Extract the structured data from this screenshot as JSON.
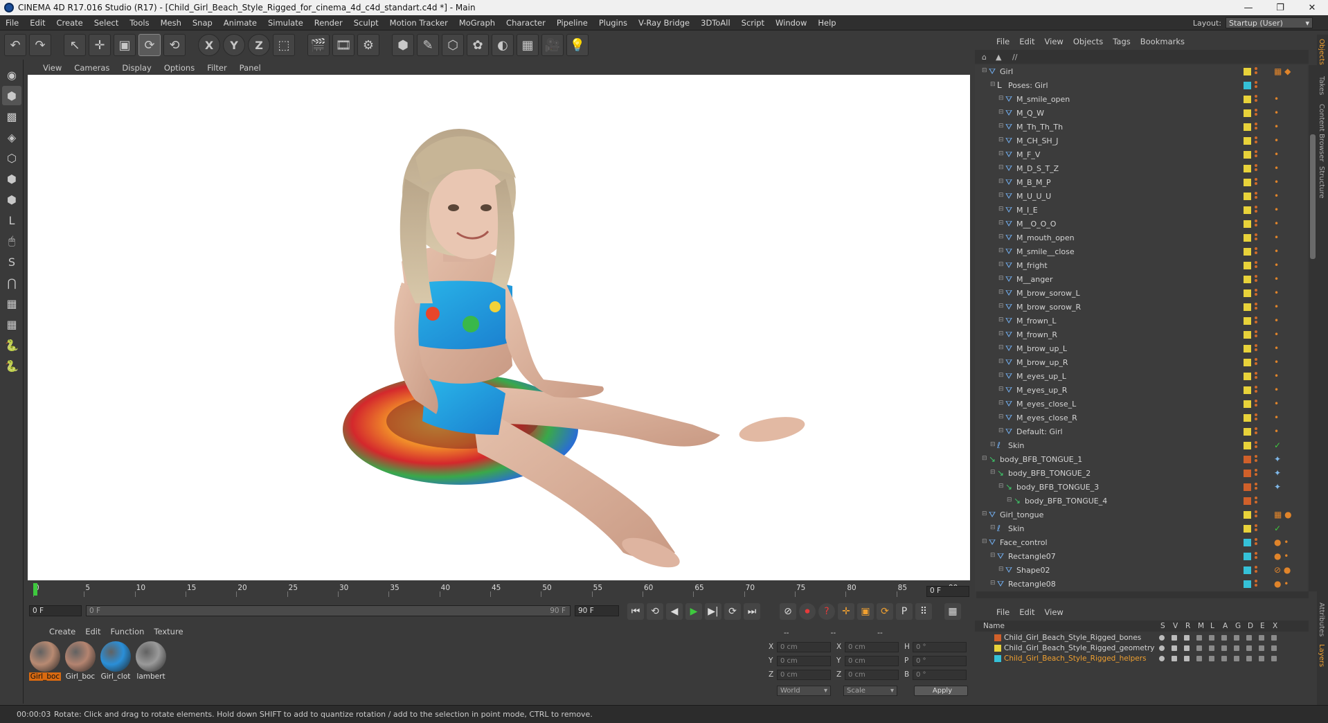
{
  "window": {
    "title": "CINEMA 4D R17.016 Studio (R17) - [Child_Girl_Beach_Style_Rigged_for_cinema_4d_c4d_standart.c4d *] - Main",
    "controls": [
      "—",
      "❐",
      "✕"
    ]
  },
  "menubar": {
    "items": [
      "File",
      "Edit",
      "Create",
      "Select",
      "Tools",
      "Mesh",
      "Snap",
      "Animate",
      "Simulate",
      "Render",
      "Sculpt",
      "Motion Tracker",
      "MoGraph",
      "Character",
      "Pipeline",
      "Plugins",
      "V-Ray Bridge",
      "3DToAll",
      "Script",
      "Window",
      "Help"
    ],
    "layout_label": "Layout:",
    "layout_value": "Startup (User)"
  },
  "toolbar": {
    "icons": [
      "undo-icon",
      "redo-icon",
      "sep",
      "select-arrow-icon",
      "move-icon",
      "scale-icon",
      "rotate-icon",
      "rotate-alt-icon",
      "sep",
      "x-axis-icon",
      "y-axis-icon",
      "z-axis-icon",
      "coordinate-system-icon",
      "sep",
      "render-view-icon",
      "render-picture-viewer-icon",
      "render-settings-icon",
      "sep",
      "cube-icon",
      "pen-icon",
      "subdivision-icon",
      "array-icon",
      "deformer-icon",
      "floor-icon",
      "camera-icon",
      "light-icon"
    ],
    "glyphs": [
      "↶",
      "↷",
      "",
      "↖",
      "✛",
      "▣",
      "⟳",
      "⟲",
      "",
      "X",
      "Y",
      "Z",
      "⬚",
      "",
      "🎬",
      "🎞",
      "⚙",
      "",
      "⬢",
      "✎",
      "⬡",
      "✿",
      "◐",
      "▦",
      "🎥",
      "💡"
    ]
  },
  "left_toolbar": {
    "icons": [
      "make-editable-icon",
      "model-mode-icon",
      "texture-mode-icon",
      "workplane-icon",
      "points-mode-icon",
      "edges-mode-icon",
      "polygons-mode-icon",
      "axis-mode-icon",
      "tweak-mode-icon",
      "solo-icon",
      "snap-magnet-icon",
      "grid-lock-icon",
      "grid-snap-icon",
      "python-icon",
      "python-alt-icon"
    ],
    "glyphs": [
      "◉",
      "⬢",
      "▩",
      "◈",
      "⬡",
      "⬢",
      "⬢",
      "L",
      "🖱",
      "S",
      "⋂",
      "▦",
      "▦",
      "🐍",
      "🐍"
    ]
  },
  "viewport": {
    "menu": [
      "View",
      "Cameras",
      "Display",
      "Options",
      "Filter",
      "Panel"
    ]
  },
  "timeline": {
    "ticks": [
      "0",
      "5",
      "10",
      "15",
      "20",
      "25",
      "30",
      "35",
      "40",
      "45",
      "50",
      "55",
      "60",
      "65",
      "70",
      "75",
      "80",
      "85",
      "90"
    ],
    "current_frame": "0 F"
  },
  "transport": {
    "start": "0 F",
    "range_start": "0 F",
    "range_end": "90 F",
    "end": "90 F",
    "buttons": [
      "⏮",
      "⟲",
      "◀",
      "▶",
      "▶|",
      "⟳",
      "⏭"
    ],
    "record_buttons": [
      "⊘",
      "⏺",
      "?",
      "✛",
      "▣",
      "⟳",
      "P",
      "⠿",
      "▦"
    ]
  },
  "materials": {
    "menu": [
      "Create",
      "Edit",
      "Function",
      "Texture"
    ],
    "items": [
      {
        "label": "Girl_boc",
        "color": "#b88a72"
      },
      {
        "label": "Girl_boc",
        "color": "#b48470"
      },
      {
        "label": "Girl_clot",
        "color": "#2a8fd8"
      },
      {
        "label": "lambert",
        "color": "#9a9a9a"
      }
    ]
  },
  "coordinates": {
    "header": [
      "--",
      "--",
      "--"
    ],
    "rows": [
      {
        "a": "X",
        "av": "0 cm",
        "b": "X",
        "bv": "0 cm",
        "c": "H",
        "cv": "0 °"
      },
      {
        "a": "Y",
        "av": "0 cm",
        "b": "Y",
        "bv": "0 cm",
        "c": "P",
        "cv": "0 °"
      },
      {
        "a": "Z",
        "av": "0 cm",
        "b": "Z",
        "bv": "0 cm",
        "c": "B",
        "cv": "0 °"
      }
    ],
    "mode1": "World",
    "mode2": "Scale",
    "apply": "Apply"
  },
  "status": {
    "time": "00:00:03",
    "message": "Rotate: Click and drag to rotate elements. Hold down SHIFT to add to quantize rotation / add to the selection in point mode, CTRL to remove."
  },
  "object_manager": {
    "menu": [
      "File",
      "Edit",
      "View",
      "Objects",
      "Tags",
      "Bookmarks"
    ],
    "path": "//",
    "rows": [
      {
        "name": "Girl",
        "indent": 0,
        "icon": "joint-icon",
        "glyph": "⛛",
        "color": "#e8d23a",
        "tags": "▦ ◆"
      },
      {
        "name": "Poses: Girl",
        "indent": 1,
        "icon": "pose-morph-icon",
        "glyph": "L",
        "color": "#35c1d8",
        "tags": ""
      },
      {
        "name": "M_smile_open",
        "indent": 2,
        "icon": "morph-icon",
        "glyph": "⛛",
        "color": "#e8d23a",
        "tags": "•"
      },
      {
        "name": "M_Q_W",
        "indent": 2,
        "icon": "morph-icon",
        "glyph": "⛛",
        "color": "#e8d23a",
        "tags": "•"
      },
      {
        "name": "M_Th_Th_Th",
        "indent": 2,
        "icon": "morph-icon",
        "glyph": "⛛",
        "color": "#e8d23a",
        "tags": "•"
      },
      {
        "name": "M_CH_SH_J",
        "indent": 2,
        "icon": "morph-icon",
        "glyph": "⛛",
        "color": "#e8d23a",
        "tags": "•"
      },
      {
        "name": "M_F_V",
        "indent": 2,
        "icon": "morph-icon",
        "glyph": "⛛",
        "color": "#e8d23a",
        "tags": "•"
      },
      {
        "name": "M_D_S_T_Z",
        "indent": 2,
        "icon": "morph-icon",
        "glyph": "⛛",
        "color": "#e8d23a",
        "tags": "•"
      },
      {
        "name": "M_B_M_P",
        "indent": 2,
        "icon": "morph-icon",
        "glyph": "⛛",
        "color": "#e8d23a",
        "tags": "•"
      },
      {
        "name": "M_U_U_U",
        "indent": 2,
        "icon": "morph-icon",
        "glyph": "⛛",
        "color": "#e8d23a",
        "tags": "•"
      },
      {
        "name": "M_I_E",
        "indent": 2,
        "icon": "morph-icon",
        "glyph": "⛛",
        "color": "#e8d23a",
        "tags": "•"
      },
      {
        "name": "M__O_O_O",
        "indent": 2,
        "icon": "morph-icon",
        "glyph": "⛛",
        "color": "#e8d23a",
        "tags": "•"
      },
      {
        "name": "M_mouth_open",
        "indent": 2,
        "icon": "morph-icon",
        "glyph": "⛛",
        "color": "#e8d23a",
        "tags": "•"
      },
      {
        "name": "M_smile__close",
        "indent": 2,
        "icon": "morph-icon",
        "glyph": "⛛",
        "color": "#e8d23a",
        "tags": "•"
      },
      {
        "name": "M_fright",
        "indent": 2,
        "icon": "morph-icon",
        "glyph": "⛛",
        "color": "#e8d23a",
        "tags": "•"
      },
      {
        "name": "M__anger",
        "indent": 2,
        "icon": "morph-icon",
        "glyph": "⛛",
        "color": "#e8d23a",
        "tags": "•"
      },
      {
        "name": "M_brow_sorow_L",
        "indent": 2,
        "icon": "morph-icon",
        "glyph": "⛛",
        "color": "#e8d23a",
        "tags": "•"
      },
      {
        "name": "M_brow_sorow_R",
        "indent": 2,
        "icon": "morph-icon",
        "glyph": "⛛",
        "color": "#e8d23a",
        "tags": "•"
      },
      {
        "name": "M_frown_L",
        "indent": 2,
        "icon": "morph-icon",
        "glyph": "⛛",
        "color": "#e8d23a",
        "tags": "•"
      },
      {
        "name": "M_frown_R",
        "indent": 2,
        "icon": "morph-icon",
        "glyph": "⛛",
        "color": "#e8d23a",
        "tags": "•"
      },
      {
        "name": "M_brow_up_L",
        "indent": 2,
        "icon": "morph-icon",
        "glyph": "⛛",
        "color": "#e8d23a",
        "tags": "•"
      },
      {
        "name": "M_brow_up_R",
        "indent": 2,
        "icon": "morph-icon",
        "glyph": "⛛",
        "color": "#e8d23a",
        "tags": "•"
      },
      {
        "name": "M_eyes_up_L",
        "indent": 2,
        "icon": "morph-icon",
        "glyph": "⛛",
        "color": "#e8d23a",
        "tags": "•"
      },
      {
        "name": "M_eyes_up_R",
        "indent": 2,
        "icon": "morph-icon",
        "glyph": "⛛",
        "color": "#e8d23a",
        "tags": "•"
      },
      {
        "name": "M_eyes_close_L",
        "indent": 2,
        "icon": "morph-icon",
        "glyph": "⛛",
        "color": "#e8d23a",
        "tags": "•"
      },
      {
        "name": "M_eyes_close_R",
        "indent": 2,
        "icon": "morph-icon",
        "glyph": "⛛",
        "color": "#e8d23a",
        "tags": "•"
      },
      {
        "name": "Default: Girl",
        "indent": 2,
        "icon": "morph-icon",
        "glyph": "⛛",
        "color": "#e8d23a",
        "tags": "•"
      },
      {
        "name": "Skin",
        "indent": 1,
        "icon": "skin-icon",
        "glyph": "ℓ",
        "color": "#e8d23a",
        "tags": "✓"
      },
      {
        "name": "body_BFB_TONGUE_1",
        "indent": 0,
        "icon": "bone-icon",
        "glyph": "↘",
        "color": "#d0602a",
        "tags": "✦"
      },
      {
        "name": "body_BFB_TONGUE_2",
        "indent": 1,
        "icon": "bone-icon",
        "glyph": "↘",
        "color": "#d0602a",
        "tags": "✦"
      },
      {
        "name": "body_BFB_TONGUE_3",
        "indent": 2,
        "icon": "bone-icon",
        "glyph": "↘",
        "color": "#d0602a",
        "tags": "✦"
      },
      {
        "name": "body_BFB_TONGUE_4",
        "indent": 3,
        "icon": "bone-icon",
        "glyph": "↘",
        "color": "#d0602a",
        "tags": ""
      },
      {
        "name": "Girl_tongue",
        "indent": 0,
        "icon": "joint-icon",
        "glyph": "⛛",
        "color": "#e8d23a",
        "tags": "▦ ●"
      },
      {
        "name": "Skin",
        "indent": 1,
        "icon": "skin-icon",
        "glyph": "ℓ",
        "color": "#e8d23a",
        "tags": "✓"
      },
      {
        "name": "Face_control",
        "indent": 0,
        "icon": "null-icon",
        "glyph": "⛛",
        "color": "#35c1d8",
        "tags": "● •"
      },
      {
        "name": "Rectangle07",
        "indent": 1,
        "icon": "spline-icon",
        "glyph": "⛛",
        "color": "#35c1d8",
        "tags": "● •"
      },
      {
        "name": "Shape02",
        "indent": 2,
        "icon": "spline-icon",
        "glyph": "⛛",
        "color": "#35c1d8",
        "tags": "⊘ ●"
      },
      {
        "name": "Rectangle08",
        "indent": 1,
        "icon": "spline-icon",
        "glyph": "⛛",
        "color": "#35c1d8",
        "tags": "● •"
      }
    ]
  },
  "layer_manager": {
    "menu": [
      "File",
      "Edit",
      "View"
    ],
    "header": {
      "name": "Name",
      "cols": [
        "S",
        "V",
        "R",
        "M",
        "L",
        "A",
        "G",
        "D",
        "E",
        "X"
      ]
    },
    "layers": [
      {
        "name": "Child_Girl_Beach_Style_Rigged_bones",
        "color": "#d0602a",
        "text_color": "#d4d4d4"
      },
      {
        "name": "Child_Girl_Beach_Style_Rigged_geometry",
        "color": "#e8d23a",
        "text_color": "#d4d4d4"
      },
      {
        "name": "Child_Girl_Beach_Style_Rigged_helpers",
        "color": "#35c1d8",
        "text_color": "#f0a030"
      }
    ]
  },
  "right_tabs": [
    "Objects",
    "Takes",
    "Content Browser",
    "Structure",
    "Attributes",
    "Layers"
  ]
}
